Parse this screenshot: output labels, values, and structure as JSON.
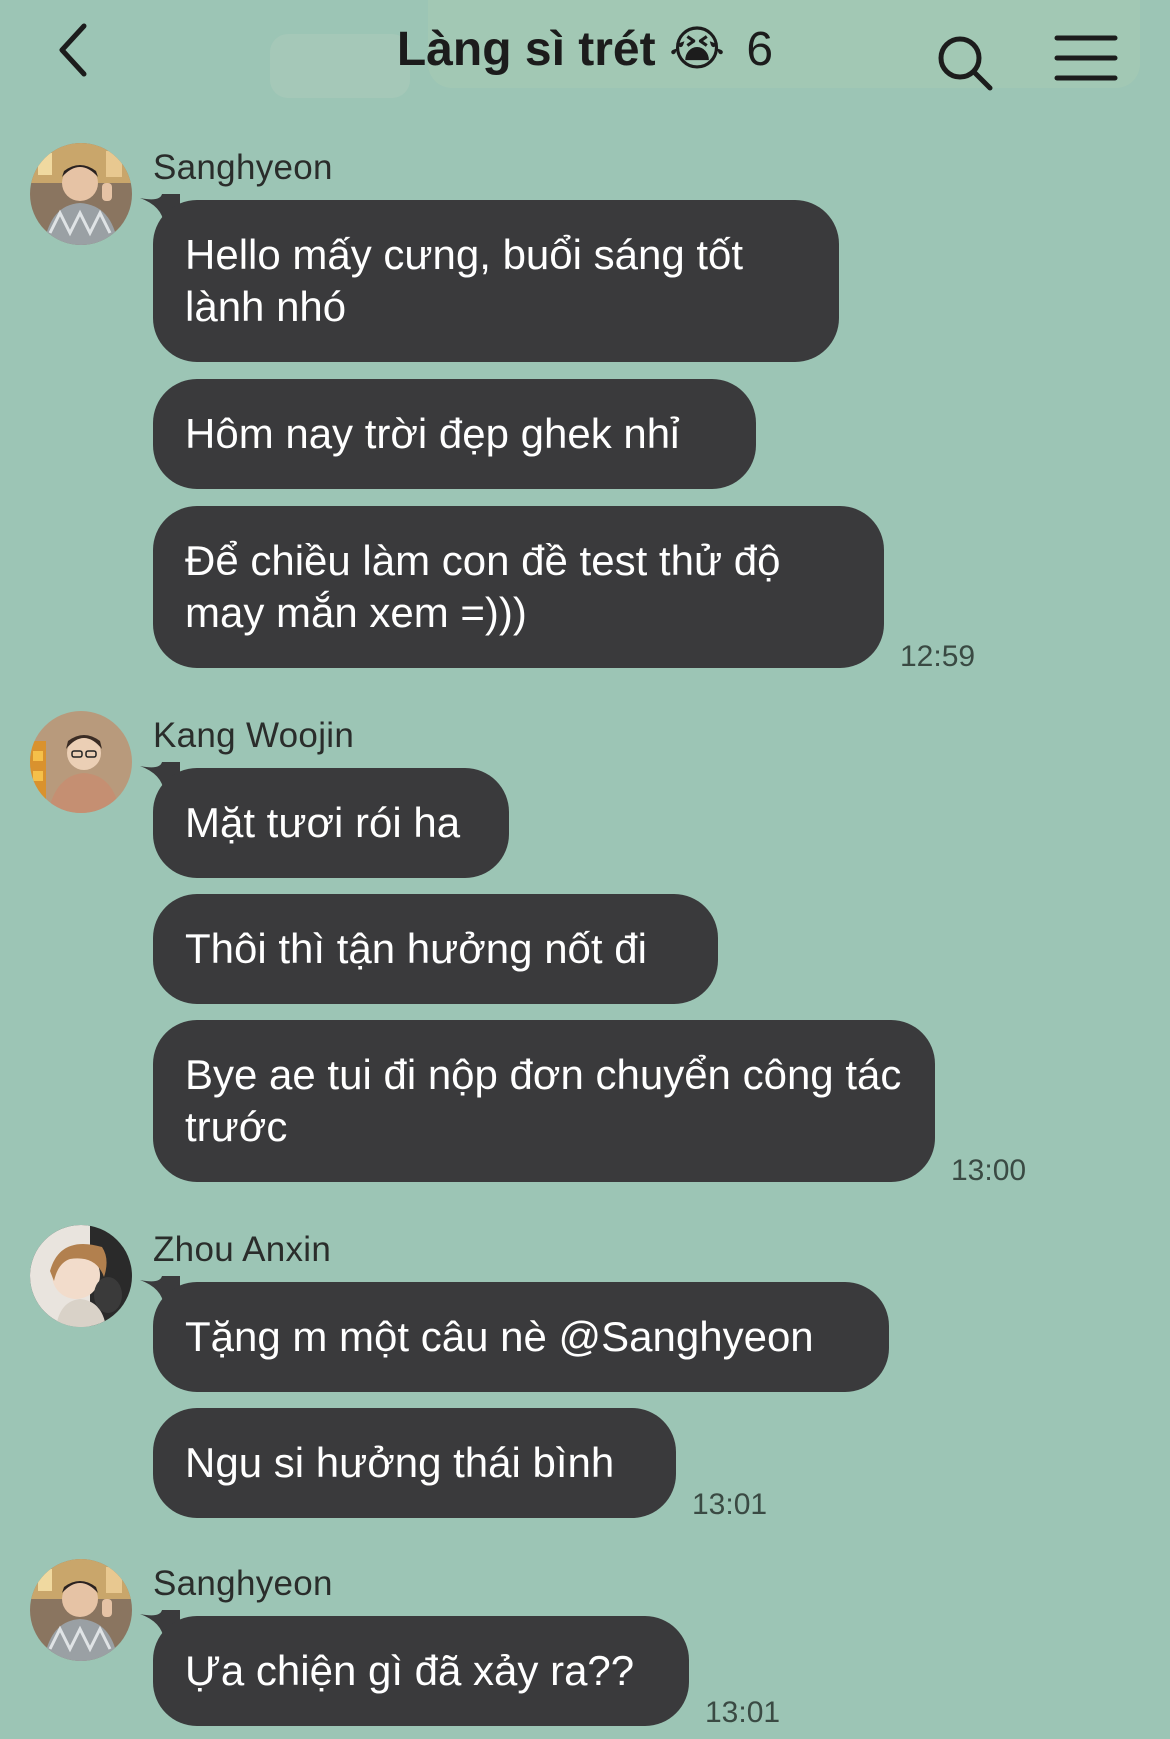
{
  "header": {
    "title": "Làng sì trét",
    "title_emoji": "😭",
    "member_count": "6",
    "back_icon": "chevron-left-icon",
    "search_icon": "search-icon",
    "menu_icon": "hamburger-menu-icon"
  },
  "messages": [
    {
      "sender": "Sanghyeon",
      "bubbles": [
        "Hello mấy cưng, buổi sáng tốt lành nhó",
        "Hôm nay trời đẹp ghek nhỉ",
        "Để chiều làm con đề test thử độ may mắn xem =)))"
      ],
      "time": "12:59"
    },
    {
      "sender": "Kang Woojin",
      "bubbles": [
        "Mặt tươi rói ha",
        "Thôi thì tận hưởng nốt đi",
        "Bye ae tui đi nộp đơn chuyển công tác trước"
      ],
      "time": "13:00"
    },
    {
      "sender": "Zhou Anxin",
      "bubbles": [
        "Tặng m một câu nè @Sanghyeon",
        "Ngu si hưởng thái bình"
      ],
      "time": "13:01"
    },
    {
      "sender": "Sanghyeon",
      "bubbles": [
        "Ựa chiện gì đã xảy ra??"
      ],
      "time": "13:01"
    }
  ],
  "colors": {
    "background": "#9cc5b5",
    "bubble": "#3a3a3c",
    "bubble_text": "#ffffff"
  }
}
